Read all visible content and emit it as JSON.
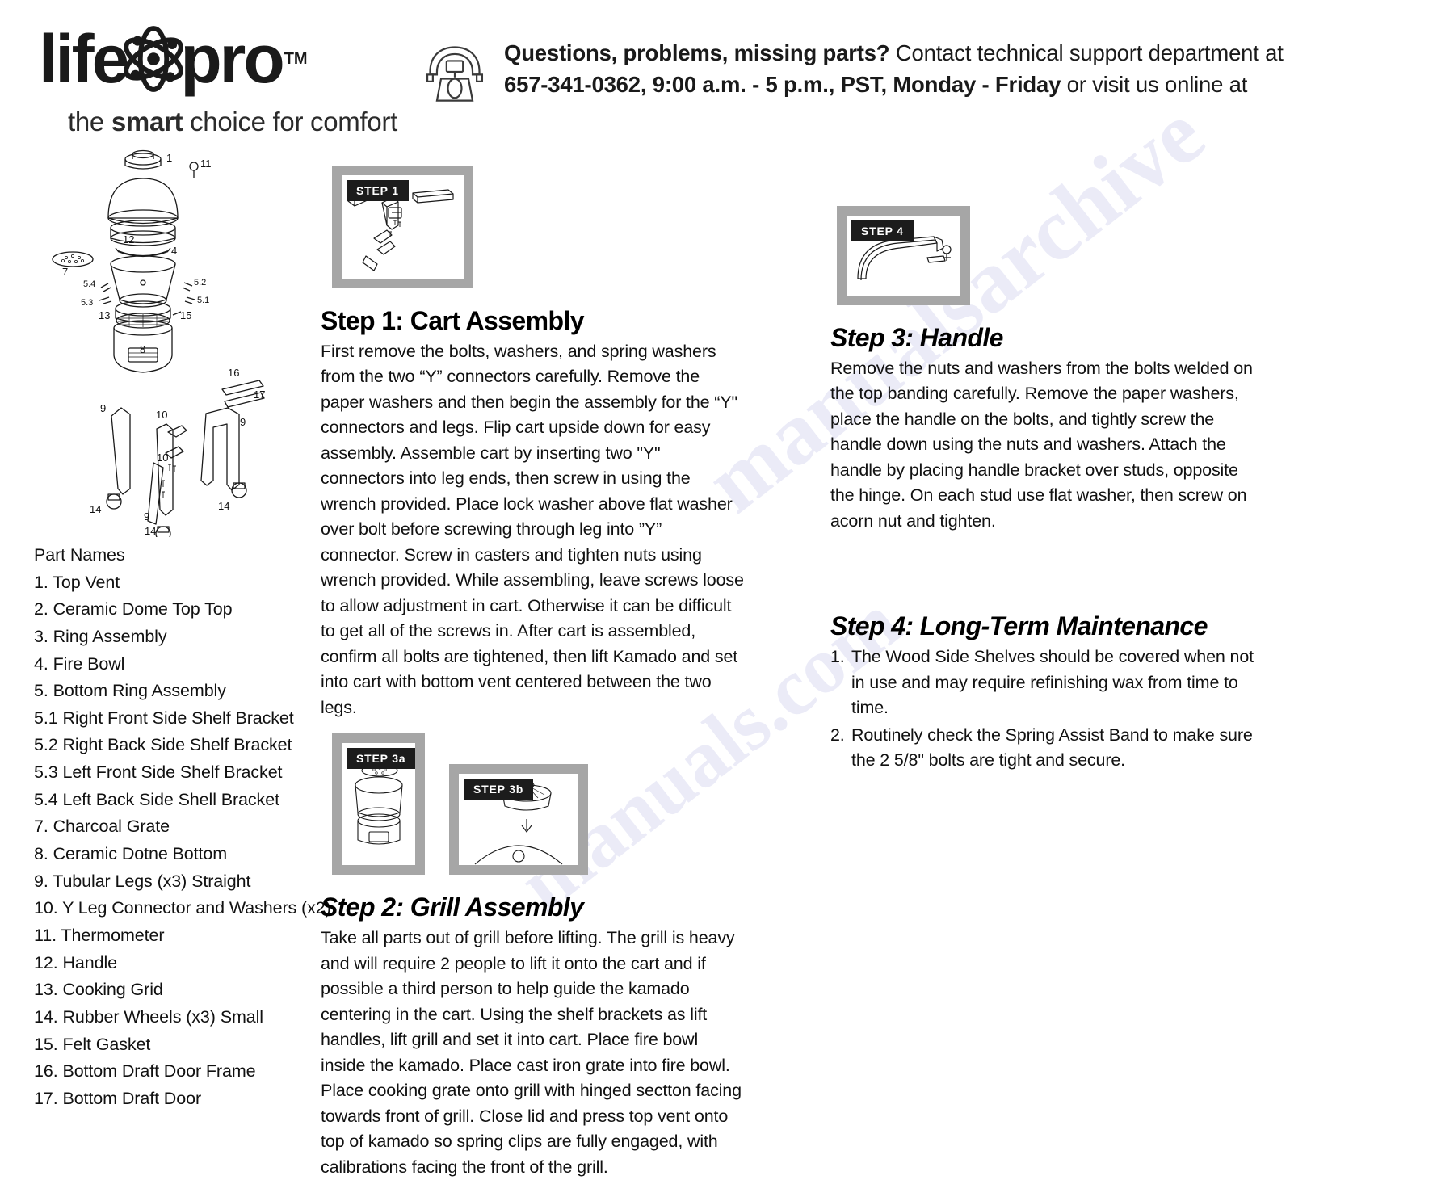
{
  "brand": {
    "word_life": "life",
    "word_pro": "pro",
    "tm": "TM",
    "atom_icon": "atom-icon",
    "tagline_pre": "the ",
    "tagline_bold": "smart",
    "tagline_post": " choice for comfort"
  },
  "support": {
    "phone_icon": "telephone-icon",
    "line1_bold": "Questions, problems, missing parts?",
    "line1_rest": " Contact technical support department at",
    "line2_bold": "657-341-0362, 9:00 a.m. - 5 p.m., PST, Monday - Friday",
    "line2_rest": " or visit us online at"
  },
  "parts": {
    "title": "Part Names",
    "items": [
      "1. Top Vent",
      "2. Ceramic Dome Top Top",
      "3. Ring Assembly",
      "4. Fire Bowl",
      "5. Bottom Ring Assembly",
      "5.1 Right Front Side Shelf Bracket",
      "5.2 Right Back Side Shelf Bracket",
      "5.3 Left Front Side Shelf Bracket",
      "5.4 Left Back Side Shell Bracket",
      "7. Charcoal Grate",
      "8. Ceramic Dotne Bottom",
      "9. Tubular Legs (x3) Straight",
      "10. Y Leg Connector and Washers (x2)",
      "11. Thermometer",
      "12. Handle",
      "13. Cooking Grid",
      "14. Rubber Wheels (x3) Small",
      "15. Felt Gasket",
      "16. Bottom Draft Door Frame",
      "17. Bottom Draft Door"
    ]
  },
  "diagram": {
    "callouts": [
      "1",
      "11",
      "12",
      "4",
      "7",
      "5.4",
      "5.2",
      "5.3",
      "5.1",
      "13",
      "15",
      "8",
      "16",
      "17",
      "9",
      "10",
      "14",
      "9",
      "10",
      "14",
      "14",
      "14"
    ]
  },
  "figures": {
    "step1": "STEP 1",
    "step3a": "STEP 3a",
    "step3b": "STEP 3b",
    "step4": "STEP 4"
  },
  "steps": {
    "step1": {
      "heading": "Step 1: Cart Assembly",
      "body": "First remove the bolts, washers, and spring washers from the two “Y”  connectors carefully. Remove the paper washers and then begin the assembly for the “Y\" connectors and legs. Flip cart upside down for easy assembly. Assemble cart by inserting two \"Y\" connectors into leg ends, then screw in using the wrench provided. Place lock washer above flat washer over bolt before screwing through leg into ”Y” connector. Screw in casters and tighten nuts using wrench provided. While assembling, leave screws loose to allow adjustment in cart. Otherwise it can be difficult to get all of the screws in. After cart is assembled, confirm all bolts are tightened, then lift Kamado and set into cart with bottom vent centered between the two legs."
    },
    "step2": {
      "heading": "Step 2: Grill Assembly",
      "body": "Take all parts out of grill before lifting. The grill is heavy and will require 2 people to lift it onto the cart and if possible a third person to help guide the kamado centering in the cart. Using the shelf brackets as lift handles, lift grill and set it into cart. Place fire bowl inside the kamado. Place cast iron grate into fire bowl. Place cooking grate onto grill with hinged sectton facing towards front of grill. Close lid and press top vent onto top of kamado so spring clips are fully engaged, with calibrations facing the front of the grill."
    },
    "step3": {
      "heading": "Step 3: Handle",
      "body": "Remove the nuts and washers from the bolts welded on the top banding carefully. Remove the paper washers, place the handle on the bolts, and tightly screw the handle down using the nuts and washers. Attach the handle by placing handle bracket over studs, opposite the hinge. On each stud use flat washer, then screw on acorn nut and tighten."
    },
    "step4": {
      "heading": "Step 4: Long-Term Maintenance",
      "items": [
        {
          "num": "1.",
          "text": "The Wood Side Shelves should be covered when not in use and may require refinishing wax from time to time."
        },
        {
          "num": "2.",
          "text": "Routinely check the Spring Assist Band to make sure the 2 5/8\" bolts are tight and secure."
        }
      ]
    }
  },
  "watermark": {
    "line_a": "manualsarchive",
    "line_b": "manuals.com"
  },
  "colors": {
    "ink": "#111111",
    "frame_gray": "#a6a6a6",
    "label_black": "#1c1c1c",
    "watermark": "#8b8fd6"
  }
}
